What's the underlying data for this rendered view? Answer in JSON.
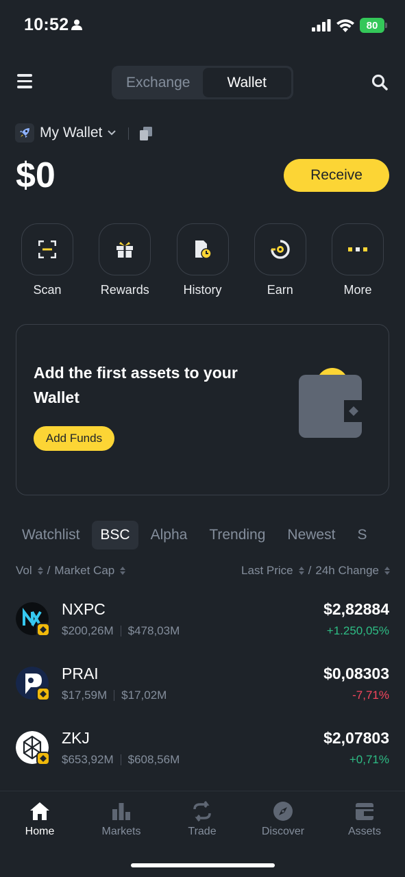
{
  "status_bar": {
    "time": "10:52",
    "battery": "80"
  },
  "header": {
    "segments": [
      "Exchange",
      "Wallet"
    ],
    "active_segment": "Wallet"
  },
  "wallet": {
    "name": "My Wallet",
    "balance": "$0",
    "receive_label": "Receive"
  },
  "actions": [
    {
      "label": "Scan",
      "icon": "scan-icon"
    },
    {
      "label": "Rewards",
      "icon": "gift-icon"
    },
    {
      "label": "History",
      "icon": "history-icon"
    },
    {
      "label": "Earn",
      "icon": "earn-icon"
    },
    {
      "label": "More",
      "icon": "more-icon"
    }
  ],
  "promo": {
    "title": "Add the first assets to your Wallet",
    "button": "Add Funds"
  },
  "tabs": [
    "Watchlist",
    "BSC",
    "Alpha",
    "Trending",
    "Newest",
    "S"
  ],
  "active_tab": "BSC",
  "columns": {
    "left_a": "Vol",
    "left_b": "Market Cap",
    "right_a": "Last Price",
    "right_b": "24h Change",
    "separator": "/"
  },
  "tokens": [
    {
      "symbol": "NXPC",
      "vol": "$200,26M",
      "mcap": "$478,03M",
      "price": "$2,82884",
      "change": "+1.250,05%",
      "direction": "up"
    },
    {
      "symbol": "PRAI",
      "vol": "$17,59M",
      "mcap": "$17,02M",
      "price": "$0,08303",
      "change": "-7,71%",
      "direction": "down"
    },
    {
      "symbol": "ZKJ",
      "vol": "$653,92M",
      "mcap": "$608,56M",
      "price": "$2,07803",
      "change": "+0,71%",
      "direction": "up"
    }
  ],
  "bottom_nav": [
    {
      "label": "Home",
      "icon": "home-icon",
      "active": true
    },
    {
      "label": "Markets",
      "icon": "markets-icon",
      "active": false
    },
    {
      "label": "Trade",
      "icon": "trade-icon",
      "active": false
    },
    {
      "label": "Discover",
      "icon": "discover-icon",
      "active": false
    },
    {
      "label": "Assets",
      "icon": "assets-icon",
      "active": false
    }
  ],
  "colors": {
    "accent": "#fcd535",
    "up": "#2ebd85",
    "down": "#f6465d",
    "background": "#1e2329"
  }
}
